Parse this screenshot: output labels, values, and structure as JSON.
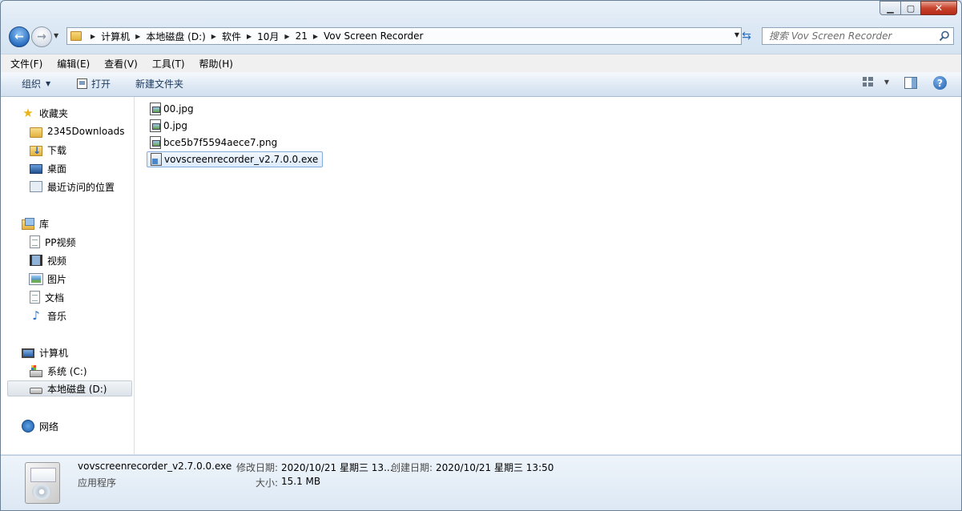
{
  "navigation": {
    "breadcrumbs": [
      "计算机",
      "本地磁盘 (D:)",
      "软件",
      "10月",
      "21",
      "Vov Screen Recorder"
    ],
    "search_placeholder": "搜索 Vov Screen Recorder"
  },
  "menu": [
    "文件(F)",
    "编辑(E)",
    "查看(V)",
    "工具(T)",
    "帮助(H)"
  ],
  "commands": {
    "organize": "组织",
    "open": "打开",
    "new_folder": "新建文件夹"
  },
  "sidebar": {
    "favorites_header": "收藏夹",
    "favorites": [
      "2345Downloads",
      "下载",
      "桌面",
      "最近访问的位置"
    ],
    "libraries_header": "库",
    "libraries": [
      "PP视频",
      "视频",
      "图片",
      "文档",
      "音乐"
    ],
    "computer_header": "计算机",
    "drives": [
      "系统 (C:)",
      "本地磁盘 (D:)"
    ],
    "network_header": "网络"
  },
  "files": [
    {
      "name": "00.jpg",
      "icon": "image-file-icon"
    },
    {
      "name": "0.jpg",
      "icon": "image-file-icon"
    },
    {
      "name": "bce5b7f5594aece7.png",
      "icon": "image-file-icon"
    },
    {
      "name": "vovscreenrecorder_v2.7.0.0.exe",
      "icon": "exe-file-icon",
      "selected": true
    }
  ],
  "details": {
    "name": "vovscreenrecorder_v2.7.0.0.exe",
    "type": "应用程序",
    "modified_label": "修改日期:",
    "modified_value": "2020/10/21 星期三 13...",
    "created_label": "创建日期:",
    "created_value": "2020/10/21 星期三 13:50",
    "size_label": "大小:",
    "size_value": "15.1 MB"
  },
  "colors": {
    "accent": "#2b6fc1",
    "selection_border": "#84acdd",
    "command_text": "#1e395b"
  }
}
